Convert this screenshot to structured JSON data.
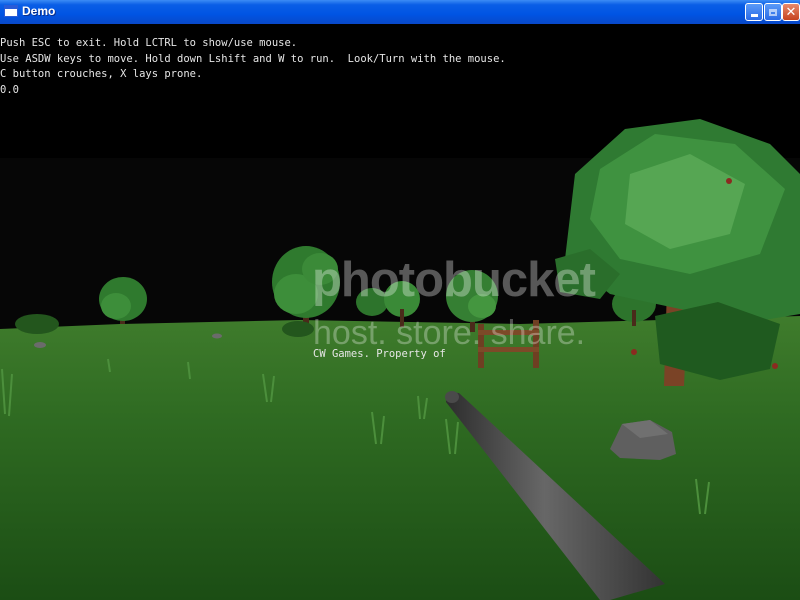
{
  "window": {
    "title": "Demo",
    "buttons": [
      "minimize",
      "maximize",
      "close"
    ]
  },
  "hud": {
    "lines": [
      "Push ESC to exit. Hold LCTRL to show/use mouse.",
      "Use ASDW keys to move. Hold down Lshift and W to run.  Look/Turn with the mouse.",
      "C button crouches, X lays prone.",
      "0.0"
    ],
    "credit": "CW Games. Property of"
  },
  "watermark": {
    "brand": "photobucket",
    "tagline": "host. store. share."
  },
  "colors": {
    "titlebar": "#0054e3",
    "sky": "#000000",
    "grass": "#2f6b22",
    "foliage": "#3a8a3a",
    "trunk": "#7a4326",
    "weapon": "#555555"
  }
}
